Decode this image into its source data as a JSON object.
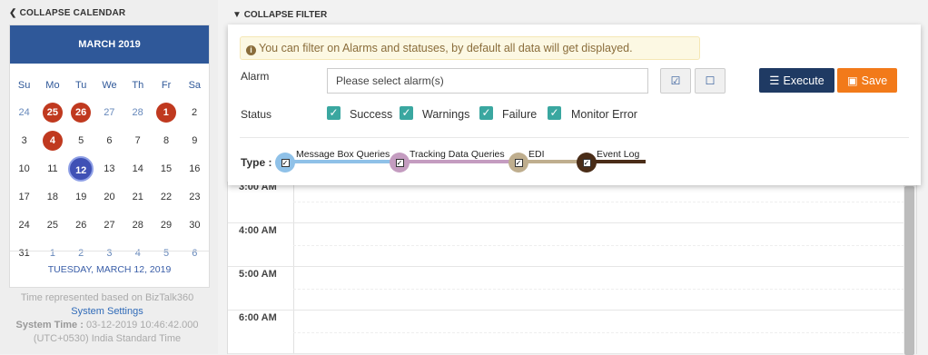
{
  "calendar": {
    "collapse_label": "COLLAPSE CALENDAR",
    "month_title": "MARCH 2019",
    "days_of_week": [
      "Su",
      "Mo",
      "Tu",
      "We",
      "Th",
      "Fr",
      "Sa"
    ],
    "weeks": [
      [
        {
          "d": "24",
          "t": "muted"
        },
        {
          "d": "25",
          "t": "alarm"
        },
        {
          "d": "26",
          "t": "alarm"
        },
        {
          "d": "27",
          "t": "muted"
        },
        {
          "d": "28",
          "t": "muted"
        },
        {
          "d": "1",
          "t": "alarm"
        },
        {
          "d": "2",
          "t": ""
        }
      ],
      [
        {
          "d": "3",
          "t": ""
        },
        {
          "d": "4",
          "t": "alarm"
        },
        {
          "d": "5",
          "t": ""
        },
        {
          "d": "6",
          "t": ""
        },
        {
          "d": "7",
          "t": ""
        },
        {
          "d": "8",
          "t": ""
        },
        {
          "d": "9",
          "t": ""
        }
      ],
      [
        {
          "d": "10",
          "t": ""
        },
        {
          "d": "11",
          "t": ""
        },
        {
          "d": "12",
          "t": "today"
        },
        {
          "d": "13",
          "t": ""
        },
        {
          "d": "14",
          "t": ""
        },
        {
          "d": "15",
          "t": ""
        },
        {
          "d": "16",
          "t": ""
        }
      ],
      [
        {
          "d": "17",
          "t": ""
        },
        {
          "d": "18",
          "t": ""
        },
        {
          "d": "19",
          "t": ""
        },
        {
          "d": "20",
          "t": ""
        },
        {
          "d": "21",
          "t": ""
        },
        {
          "d": "22",
          "t": ""
        },
        {
          "d": "23",
          "t": ""
        }
      ],
      [
        {
          "d": "24",
          "t": ""
        },
        {
          "d": "25",
          "t": ""
        },
        {
          "d": "26",
          "t": ""
        },
        {
          "d": "27",
          "t": ""
        },
        {
          "d": "28",
          "t": ""
        },
        {
          "d": "29",
          "t": ""
        },
        {
          "d": "30",
          "t": ""
        }
      ],
      [
        {
          "d": "31",
          "t": ""
        },
        {
          "d": "1",
          "t": "muted"
        },
        {
          "d": "2",
          "t": "muted"
        },
        {
          "d": "3",
          "t": "muted"
        },
        {
          "d": "4",
          "t": "muted"
        },
        {
          "d": "5",
          "t": "muted"
        },
        {
          "d": "6",
          "t": "muted"
        }
      ]
    ],
    "selected_date": "TUESDAY, MARCH 12, 2019"
  },
  "timezone": {
    "line1": "Time represented based on BizTalk360",
    "settings_link": "System Settings",
    "system_time_label": "System Time :",
    "system_time_value": "03-12-2019 10:46:42.000",
    "zone": "(UTC+0530) India Standard Time"
  },
  "filter": {
    "collapse_label": "COLLAPSE FILTER",
    "info_text": "You can filter on Alarms and statuses, by default all data will get displayed.",
    "alarm_label": "Alarm",
    "alarm_placeholder": "Please select alarm(s)",
    "execute_label": "Execute",
    "save_label": "Save",
    "status_label": "Status",
    "statuses": [
      "Success",
      "Warnings",
      "Failure",
      "Monitor Error"
    ],
    "type_label": "Type :",
    "types": [
      {
        "label": "Message Box Queries",
        "color": "#8fc1e8",
        "line": "#8fc1e8"
      },
      {
        "label": "Tracking Data Queries",
        "color": "#c49cc0",
        "line": "#c49cc0"
      },
      {
        "label": "EDI",
        "color": "#bfae8e",
        "line": "#bfae8e"
      },
      {
        "label": "Event Log",
        "color": "#4a2d18",
        "line": "#4a2d18"
      }
    ]
  },
  "schedule": {
    "times": [
      "3:00 AM",
      "4:00 AM",
      "5:00 AM",
      "6:00 AM"
    ]
  },
  "colors": {
    "header_blue": "#2f5899",
    "alarm_red": "#c0391f",
    "execute_navy": "#1f3a63",
    "save_orange": "#f27a1a",
    "check_teal": "#3aa7a0"
  }
}
